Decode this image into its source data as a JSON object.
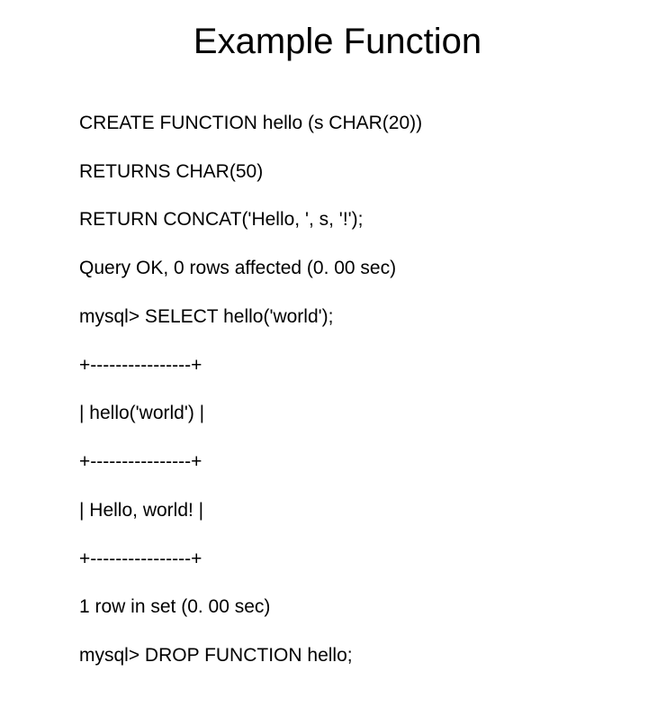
{
  "title": "Example Function",
  "lines": [
    "CREATE FUNCTION hello (s CHAR(20))",
    "RETURNS CHAR(50)",
    "RETURN CONCAT('Hello, ', s, '!');",
    "Query OK, 0 rows affected (0. 00 sec)",
    "mysql> SELECT hello('world');",
    "+----------------+",
    "| hello('world') |",
    "+----------------+",
    "| Hello, world! |",
    "+----------------+",
    "1 row in set (0. 00 sec)",
    "mysql> DROP FUNCTION hello;"
  ]
}
